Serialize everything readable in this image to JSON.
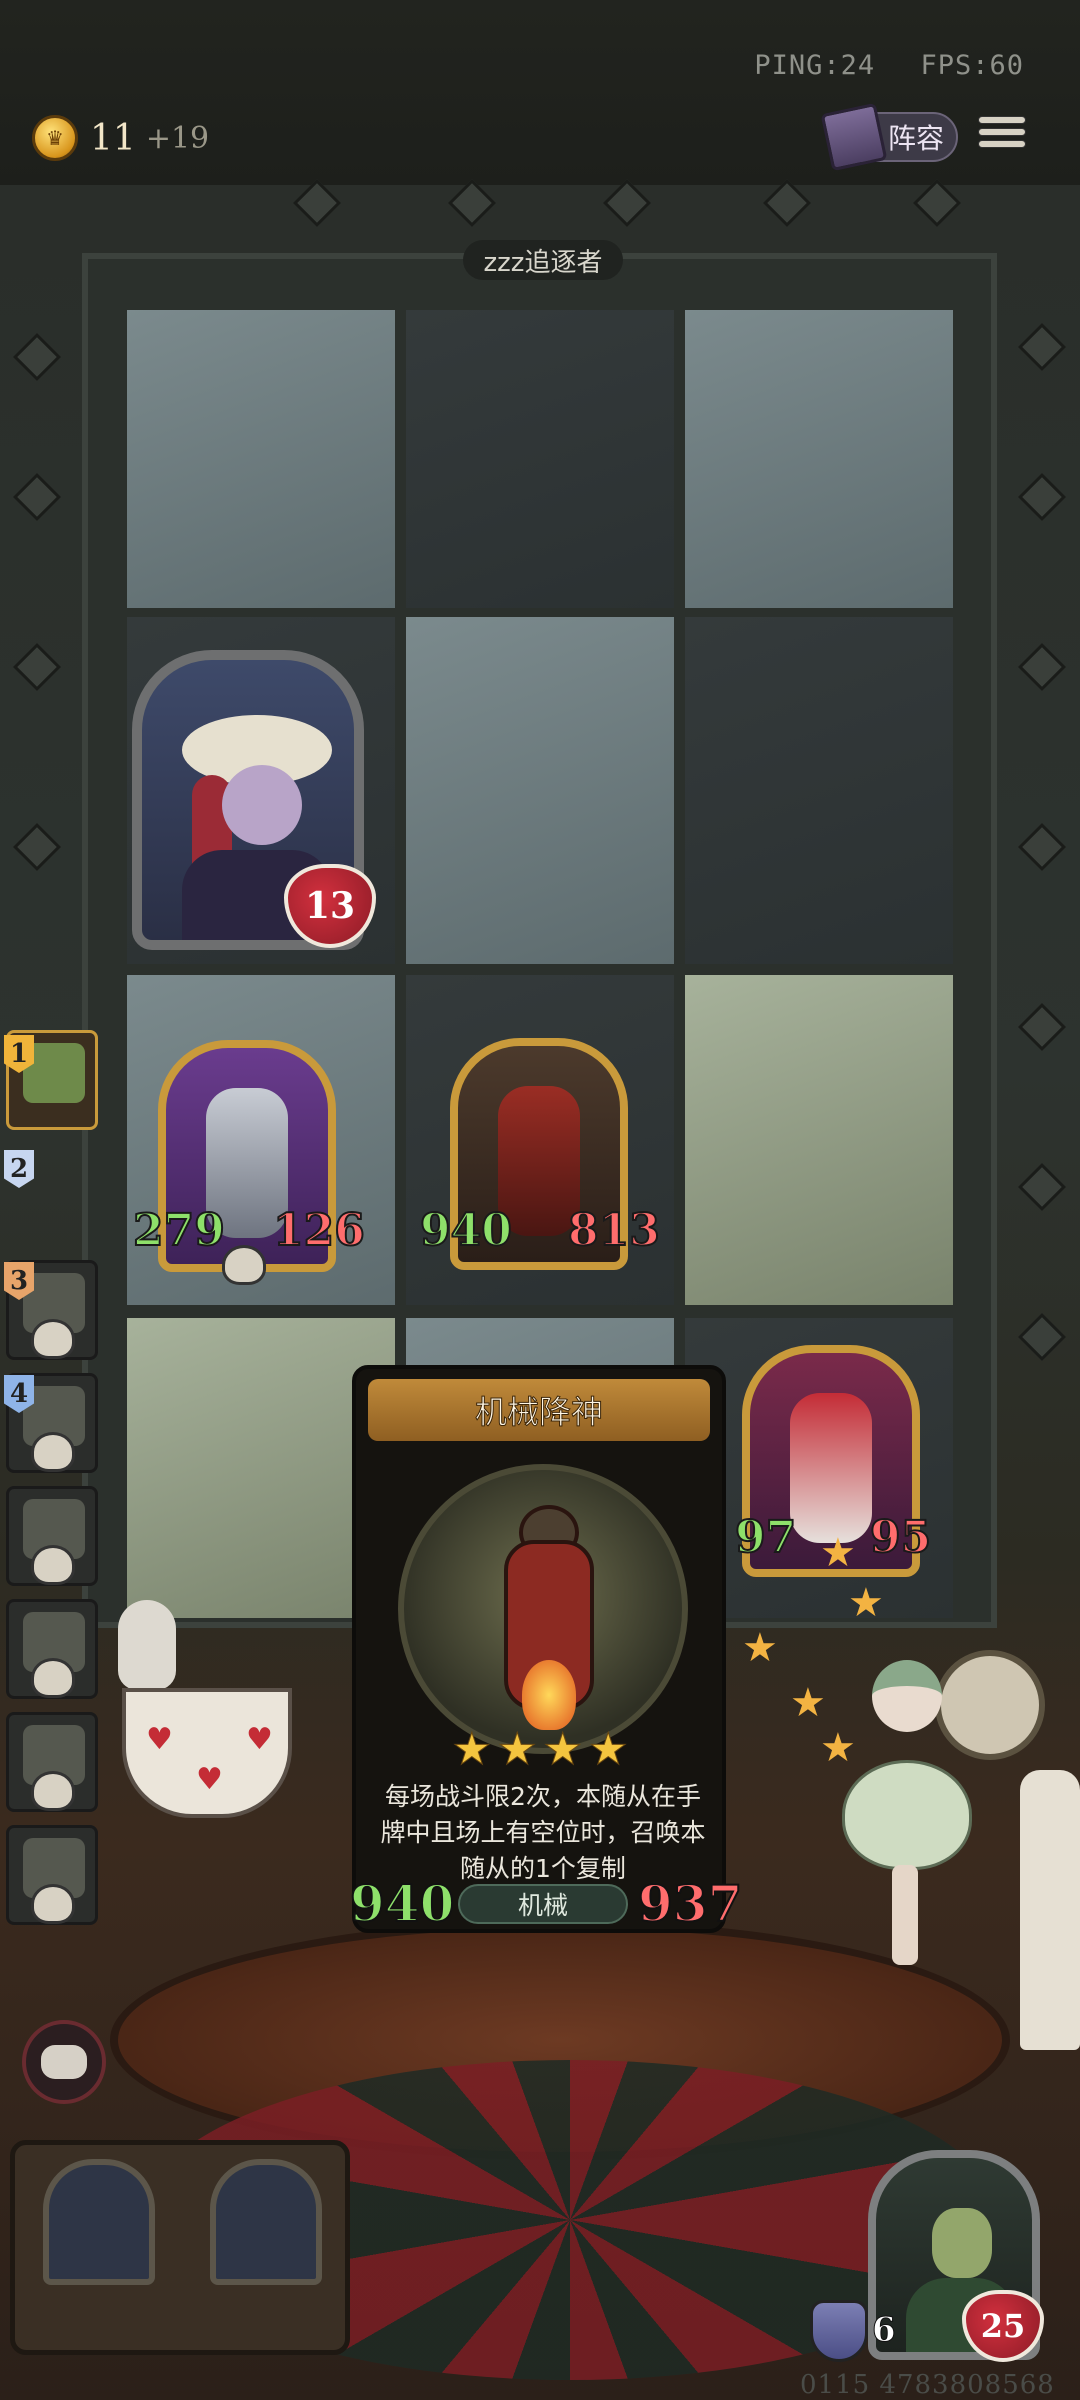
{
  "status": {
    "ping": "PING:24",
    "fps": "FPS:60"
  },
  "gold": {
    "value": "11",
    "income": "+19"
  },
  "topbar": {
    "lineup_label": "阵容"
  },
  "opponent": {
    "name": "zzz追逐者",
    "hero_health": "13"
  },
  "board": {
    "minions": [
      {
        "attack": "279",
        "health": "126"
      },
      {
        "attack": "940",
        "health": "813"
      },
      {
        "attack": "97",
        "health": "95"
      }
    ]
  },
  "sidebar": {
    "ranks": [
      "1",
      "2",
      "3",
      "4"
    ]
  },
  "card": {
    "name": "机械降神",
    "stars": "★★★★",
    "description": "每场战斗限2次，本随从在手牌中且场上有空位时，召唤本随从的1个复制",
    "tribe": "机械",
    "attack": "940",
    "health": "937"
  },
  "player": {
    "armor": "6",
    "health": "25",
    "id": "0115 4783808568"
  },
  "colors": {
    "accent_gold": "#c99a3b",
    "attack_green": "#8ee06a",
    "health_red": "#ff6d6d"
  }
}
